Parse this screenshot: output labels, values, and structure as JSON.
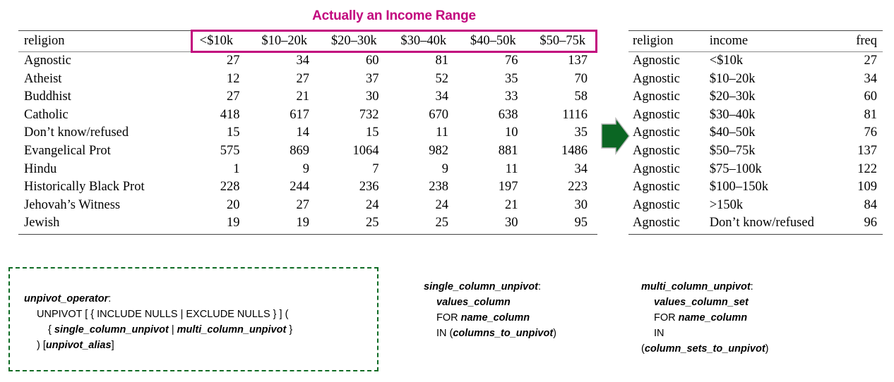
{
  "highlight": {
    "title": "Actually an Income Range",
    "color": "#C2077E"
  },
  "arrow": {
    "name": "green-right-arrow",
    "color": "#0B6623"
  },
  "wide_table": {
    "name": "wide-religion-income-table",
    "headers": [
      "religion",
      "<$10k",
      "$10–20k",
      "$20–30k",
      "$30–40k",
      "$40–50k",
      "$50–75k"
    ],
    "rows": [
      [
        "Agnostic",
        "27",
        "34",
        "60",
        "81",
        "76",
        "137"
      ],
      [
        "Atheist",
        "12",
        "27",
        "37",
        "52",
        "35",
        "70"
      ],
      [
        "Buddhist",
        "27",
        "21",
        "30",
        "34",
        "33",
        "58"
      ],
      [
        "Catholic",
        "418",
        "617",
        "732",
        "670",
        "638",
        "1116"
      ],
      [
        "Don’t know/refused",
        "15",
        "14",
        "15",
        "11",
        "10",
        "35"
      ],
      [
        "Evangelical Prot",
        "575",
        "869",
        "1064",
        "982",
        "881",
        "1486"
      ],
      [
        "Hindu",
        "1",
        "9",
        "7",
        "9",
        "11",
        "34"
      ],
      [
        "Historically Black Prot",
        "228",
        "244",
        "236",
        "238",
        "197",
        "223"
      ],
      [
        "Jehovah’s Witness",
        "20",
        "27",
        "24",
        "24",
        "21",
        "30"
      ],
      [
        "Jewish",
        "19",
        "19",
        "25",
        "25",
        "30",
        "95"
      ]
    ]
  },
  "long_table": {
    "name": "long-unpivoted-table",
    "headers": [
      "religion",
      "income",
      "freq"
    ],
    "rows": [
      [
        "Agnostic",
        "<$10k",
        "27"
      ],
      [
        "Agnostic",
        "$10–20k",
        "34"
      ],
      [
        "Agnostic",
        "$20–30k",
        "60"
      ],
      [
        "Agnostic",
        "$30–40k",
        "81"
      ],
      [
        "Agnostic",
        "$40–50k",
        "76"
      ],
      [
        "Agnostic",
        "$50–75k",
        "137"
      ],
      [
        "Agnostic",
        "$75–100k",
        "122"
      ],
      [
        "Agnostic",
        "$100–150k",
        "109"
      ],
      [
        "Agnostic",
        ">150k",
        "84"
      ],
      [
        "Agnostic",
        "Don’t know/refused",
        "96"
      ]
    ]
  },
  "syntax": {
    "operator": {
      "border_color": "#0E6B24",
      "lines": [
        [
          {
            "t": "unpivot_operator",
            "s": "ph"
          },
          {
            "t": ":",
            "s": "kw"
          }
        ],
        [
          {
            "t": "UNPIVOT [ { INCLUDE NULLS | EXCLUDE NULLS } ] (",
            "s": "kw"
          }
        ],
        [
          {
            "t": "{ ",
            "s": "kw"
          },
          {
            "t": "single_column_unpivot",
            "s": "ph"
          },
          {
            "t": " | ",
            "s": "kw"
          },
          {
            "t": "multi_column_unpivot",
            "s": "ph"
          },
          {
            "t": " }",
            "s": "kw"
          }
        ],
        [
          {
            "t": ") [",
            "s": "kw"
          },
          {
            "t": "unpivot_alias",
            "s": "ph"
          },
          {
            "t": "]",
            "s": "kw"
          }
        ]
      ]
    },
    "single": {
      "lines": [
        [
          {
            "t": "single_column_unpivot",
            "s": "ph"
          },
          {
            "t": ":",
            "s": "kw"
          }
        ],
        [
          {
            "t": "values_column",
            "s": "ph"
          }
        ],
        [
          {
            "t": "FOR ",
            "s": "kw"
          },
          {
            "t": "name_column",
            "s": "ph"
          }
        ],
        [
          {
            "t": "IN (",
            "s": "kw"
          },
          {
            "t": "columns_to_unpivot",
            "s": "ph"
          },
          {
            "t": ")",
            "s": "kw"
          }
        ]
      ]
    },
    "multi": {
      "lines": [
        [
          {
            "t": "multi_column_unpivot",
            "s": "ph"
          },
          {
            "t": ":",
            "s": "kw"
          }
        ],
        [
          {
            "t": "values_column_set",
            "s": "ph"
          }
        ],
        [
          {
            "t": "FOR ",
            "s": "kw"
          },
          {
            "t": "name_column",
            "s": "ph"
          }
        ],
        [
          {
            "t": "IN",
            "s": "kw"
          }
        ],
        [
          {
            "t": "(",
            "s": "kw"
          },
          {
            "t": "column_sets_to_unpivot",
            "s": "ph"
          },
          {
            "t": ")",
            "s": "kw"
          }
        ]
      ]
    }
  }
}
